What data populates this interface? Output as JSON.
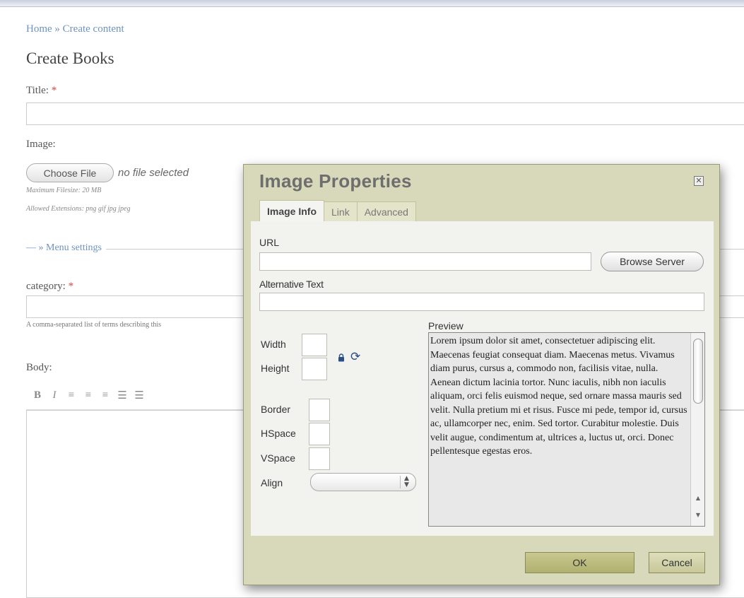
{
  "page": {
    "breadcrumb": "Home » Create content",
    "title": "Create Books",
    "title_label": "Title:",
    "required_mark": "*",
    "image_label": "Image:",
    "choose_file_label": "Choose File",
    "no_file_text": "no file selected",
    "max_filesize": "Maximum Filesize: 20 MB",
    "allowed_extensions": "Allowed Extensions: png gif jpg jpeg",
    "menu_settings_label": "» Menu settings",
    "category_label": "category:",
    "category_desc": "A comma-separated list of terms describing this",
    "body_label": "Body:",
    "toolbar_icons": [
      "B",
      "I",
      "≡",
      "≡",
      "≡",
      "☰",
      "☰"
    ]
  },
  "dialog": {
    "title": "Image Properties",
    "close_glyph": "✕",
    "tabs": [
      {
        "label": "Image Info",
        "active": true
      },
      {
        "label": "Link",
        "active": false
      },
      {
        "label": "Advanced",
        "active": false
      }
    ],
    "url_label": "URL",
    "url_value": "",
    "browse_label": "Browse Server",
    "alt_label": "Alternative Text",
    "alt_value": "",
    "width_label": "Width",
    "height_label": "Height",
    "border_label": "Border",
    "hspace_label": "HSpace",
    "vspace_label": "VSpace",
    "align_label": "Align",
    "align_value": "",
    "preview_label": "Preview",
    "preview_text": "Lorem ipsum dolor sit amet, consectetuer adipiscing elit. Maecenas feugiat consequat diam. Maecenas metus. Vivamus diam purus, cursus a, commodo non, facilisis vitae, nulla. Aenean dictum lacinia tortor. Nunc iaculis, nibh non iaculis aliquam, orci felis euismod neque, sed ornare massa mauris sed velit. Nulla pretium mi et risus. Fusce mi pede, tempor id, cursus ac, ullamcorper nec, enim. Sed tortor. Curabitur molestie. Duis velit augue, condimentum at, ultrices a, luctus ut, orci. Donec pellentesque egestas eros.",
    "reset_glyph": "⟳",
    "ok_label": "OK",
    "cancel_label": "Cancel"
  }
}
